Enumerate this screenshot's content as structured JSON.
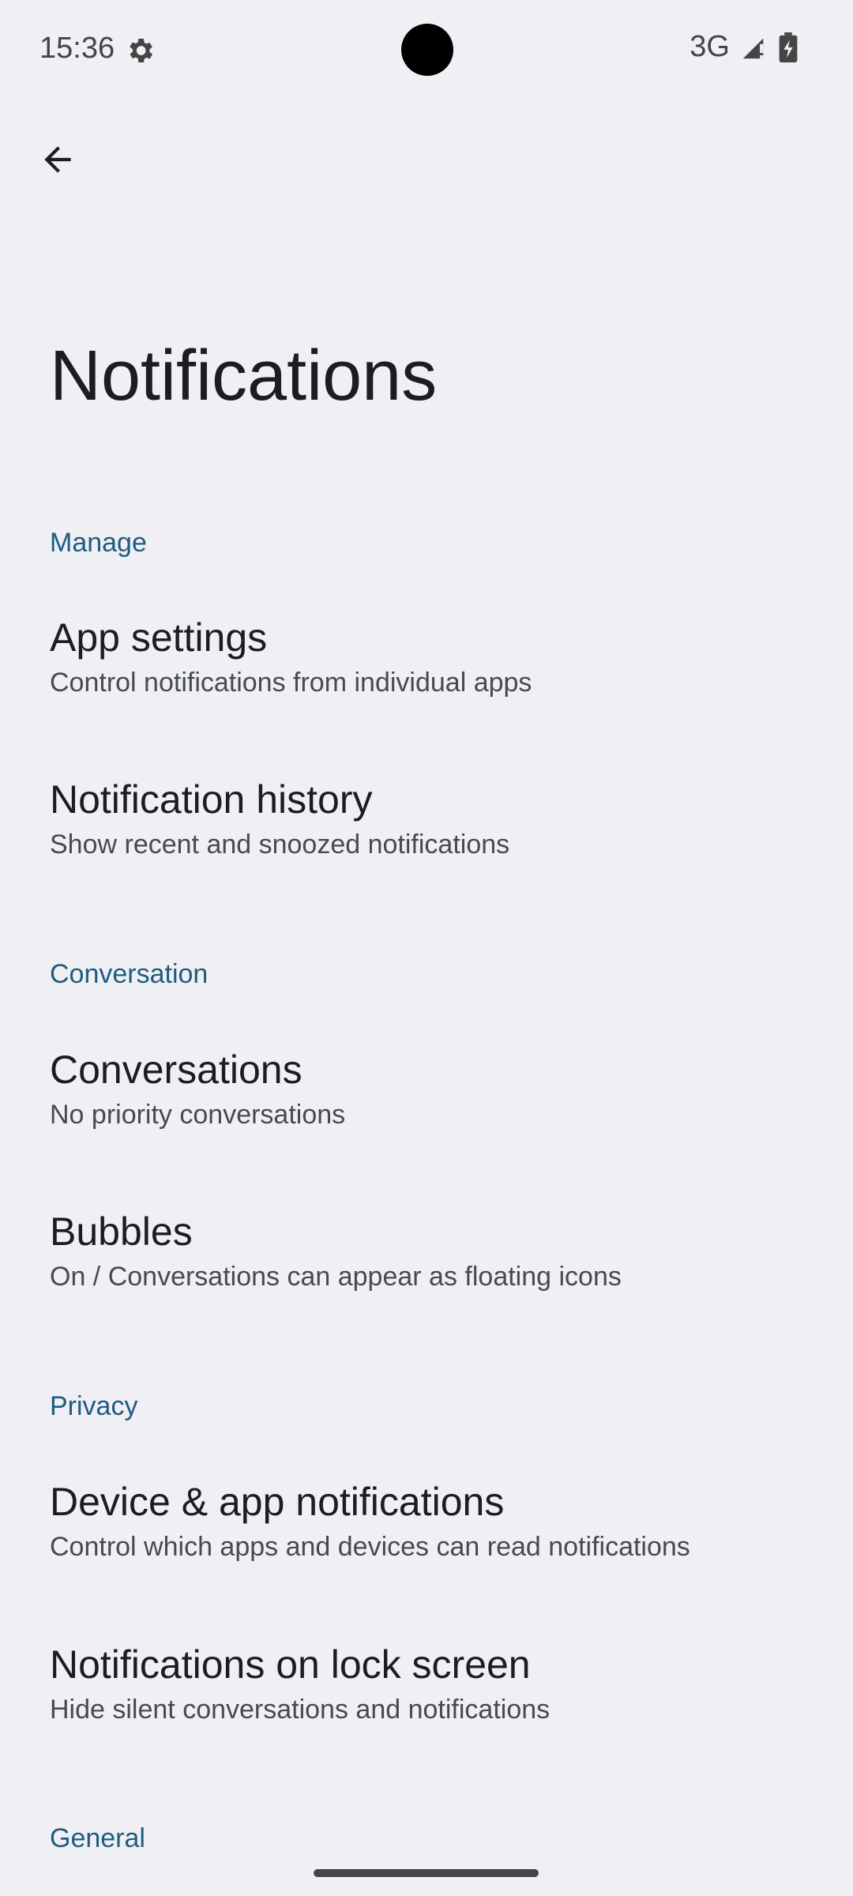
{
  "status_bar": {
    "time": "15:36",
    "network": "3G"
  },
  "page": {
    "title": "Notifications"
  },
  "sections": {
    "manage": {
      "header": "Manage",
      "items": [
        {
          "title": "App settings",
          "subtitle": "Control notifications from individual apps"
        },
        {
          "title": "Notification history",
          "subtitle": "Show recent and snoozed notifications"
        }
      ]
    },
    "conversation": {
      "header": "Conversation",
      "items": [
        {
          "title": "Conversations",
          "subtitle": "No priority conversations"
        },
        {
          "title": "Bubbles",
          "subtitle": "On / Conversations can appear as floating icons"
        }
      ]
    },
    "privacy": {
      "header": "Privacy",
      "items": [
        {
          "title": "Device & app notifications",
          "subtitle": "Control which apps and devices can read notifications"
        },
        {
          "title": "Notifications on lock screen",
          "subtitle": "Hide silent conversations and notifications"
        }
      ]
    },
    "general": {
      "header": "General"
    }
  },
  "colors": {
    "background": "#f0eff4",
    "section_header": "#1d5d7e",
    "title_text": "#1d1d1f",
    "subtitle_text": "#454b52"
  },
  "icons": [
    "gear-icon",
    "signal-icon",
    "battery-charging-icon",
    "back-arrow-icon"
  ]
}
